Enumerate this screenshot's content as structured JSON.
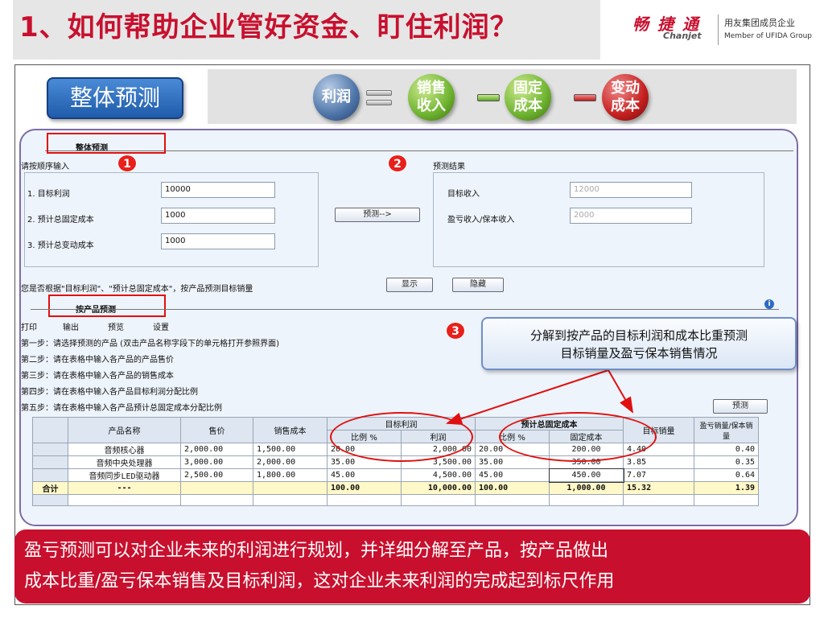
{
  "header": {
    "title": "1、如何帮助企业管好资金、盯住利润？",
    "brand_cn": "畅 捷 通",
    "brand_en": "Chanjet",
    "group_cn": "用友集团成员企业",
    "group_en": "Member of UFIDA Group"
  },
  "tag": "整体预测",
  "formula": {
    "profit": "利润",
    "sales_l1": "销售",
    "sales_l2": "收入",
    "fixed_l1": "固定",
    "fixed_l2": "成本",
    "var_l1": "变动",
    "var_l2": "成本"
  },
  "screen": {
    "section1_title": "整体预测",
    "input_prompt": "请按顺序输入",
    "result_title": "预测结果",
    "fields": [
      {
        "label": "1. 目标利润",
        "value": "10000"
      },
      {
        "label": "2. 预计总固定成本",
        "value": "1000"
      },
      {
        "label": "3. 预计总变动成本",
        "value": "1000"
      }
    ],
    "predict_button": "预测-->",
    "results": [
      {
        "label": "目标收入",
        "value": "12000"
      },
      {
        "label": "盈亏收入/保本收入",
        "value": "2000"
      }
    ],
    "question": "您是否根据\"目标利润\"、\"预计总固定成本\"，按产品预测目标销量",
    "show_button": "显示",
    "hide_button": "隐藏",
    "section2_title": "按产品预测",
    "toolbar": [
      "打印",
      "输出",
      "预览",
      "设置"
    ],
    "steps": [
      "第一步：请选择预测的产品 (双击产品名称字段下的单元格打开参照界面)",
      "第二步：请在表格中输入各产品的产品售价",
      "第三步：请在表格中输入各产品的销售成本",
      "第四步：请在表格中输入各产品目标利润分配比例",
      "第五步：请在表格中输入各产品预计总固定成本分配比例"
    ],
    "predict_button2": "预测",
    "badges": [
      "1",
      "2",
      "3"
    ]
  },
  "grid": {
    "head": {
      "name": "产品名称",
      "price": "售价",
      "cost": "销售成本",
      "profit_group": "目标利润",
      "fixed_group": "预计总固定成本",
      "target_qty": "目标销量",
      "breakeven": "盈亏销量/保本销量",
      "ratio": "比例 %",
      "profit": "利润",
      "fixed": "固定成本"
    },
    "rows": [
      {
        "name": "音频核心器",
        "price": "2,000.00",
        "cost": "1,500.00",
        "pr": "20.00",
        "pv": "2,000.00",
        "fr": "20.00",
        "fv": "200.00",
        "tq": "4.40",
        "be": "0.40"
      },
      {
        "name": "音频中央处理器",
        "price": "3,000.00",
        "cost": "2,000.00",
        "pr": "35.00",
        "pv": "3,500.00",
        "fr": "35.00",
        "fv": "350.00",
        "tq": "3.85",
        "be": "0.35"
      },
      {
        "name": "音频同步LED驱动器",
        "price": "2,500.00",
        "cost": "1,800.00",
        "pr": "45.00",
        "pv": "4,500.00",
        "fr": "45.00",
        "fv": "450.00",
        "tq": "7.07",
        "be": "0.64"
      }
    ],
    "total": {
      "label": "合计",
      "name": "---",
      "pr": "100.00",
      "pv": "10,000.00",
      "fr": "100.00",
      "fv": "1,000.00",
      "tq": "15.32",
      "be": "1.39"
    }
  },
  "callout": {
    "line1": "分解到按产品的目标利润和成本比重预测",
    "line2": "目标销量及盈亏保本销售情况"
  },
  "banner": {
    "line1": "盈亏预测可以对企业未来的利润进行规划，并详细分解至产品，按产品做出",
    "line2": "成本比重/盈亏保本销售及目标利润，这对企业未来利润的完成起到标尺作用"
  },
  "colors": {
    "brand_red": "#c8102e",
    "tag_blue": "#2a6bbf",
    "callout_border": "#6f8fc5"
  }
}
